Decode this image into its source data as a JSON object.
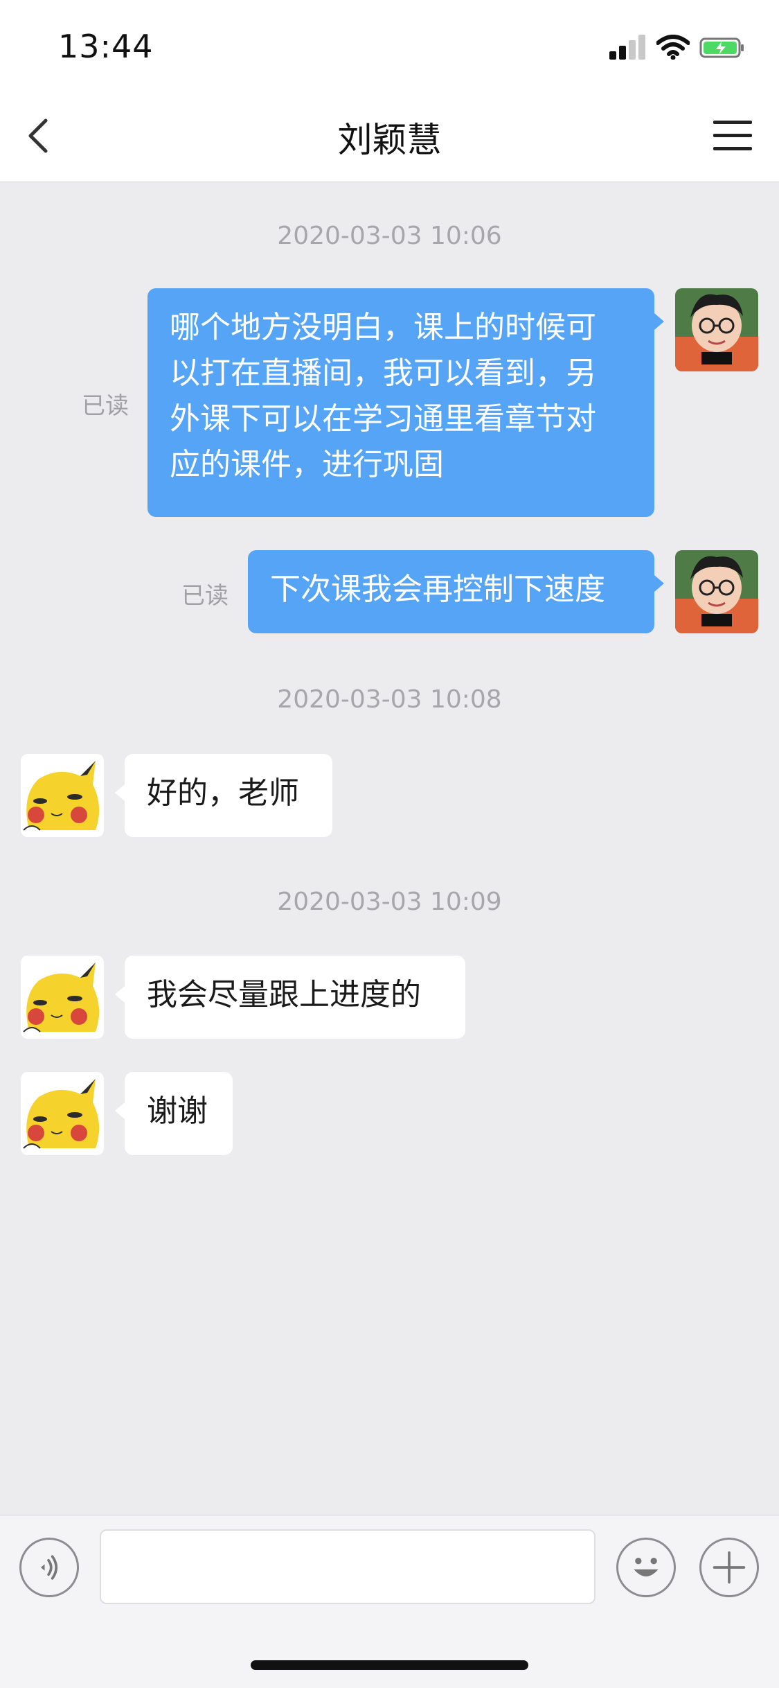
{
  "status_bar": {
    "time": "13:44",
    "icons": {
      "signal": "cellular-signal-icon",
      "wifi": "wifi-icon",
      "battery": "battery-charging-icon"
    }
  },
  "header": {
    "title": "刘颖慧",
    "back_icon": "chevron-left-icon",
    "menu_icon": "menu-icon"
  },
  "messages": [
    {
      "timestamp": "2020-03-03 10:06",
      "items": [
        {
          "sender": "me",
          "avatar": "teacher-avatar",
          "status": "已读",
          "lines": [
            "哪个地方没明白，课上的时候可",
            "以打在直播间，我可以看到，另",
            "外课下可以在学习通里看章节对",
            "应的课件，进行巩固"
          ]
        },
        {
          "sender": "me",
          "avatar": "teacher-avatar",
          "status": "已读",
          "lines": [
            "下次课我会再控制下速度"
          ]
        }
      ]
    },
    {
      "timestamp": "2020-03-03 10:08",
      "items": [
        {
          "sender": "other",
          "avatar": "pikachu-avatar",
          "lines": [
            "好的，老师"
          ]
        }
      ]
    },
    {
      "timestamp": "2020-03-03 10:09",
      "items": [
        {
          "sender": "other",
          "avatar": "pikachu-avatar",
          "lines": [
            "我会尽量跟上进度的"
          ]
        },
        {
          "sender": "other",
          "avatar": "pikachu-avatar",
          "lines": [
            "谢谢"
          ]
        }
      ]
    }
  ],
  "input_bar": {
    "voice_icon": "voice-icon",
    "emoji_icon": "emoji-icon",
    "plus_icon": "plus-icon",
    "input_value": "",
    "placeholder": ""
  }
}
